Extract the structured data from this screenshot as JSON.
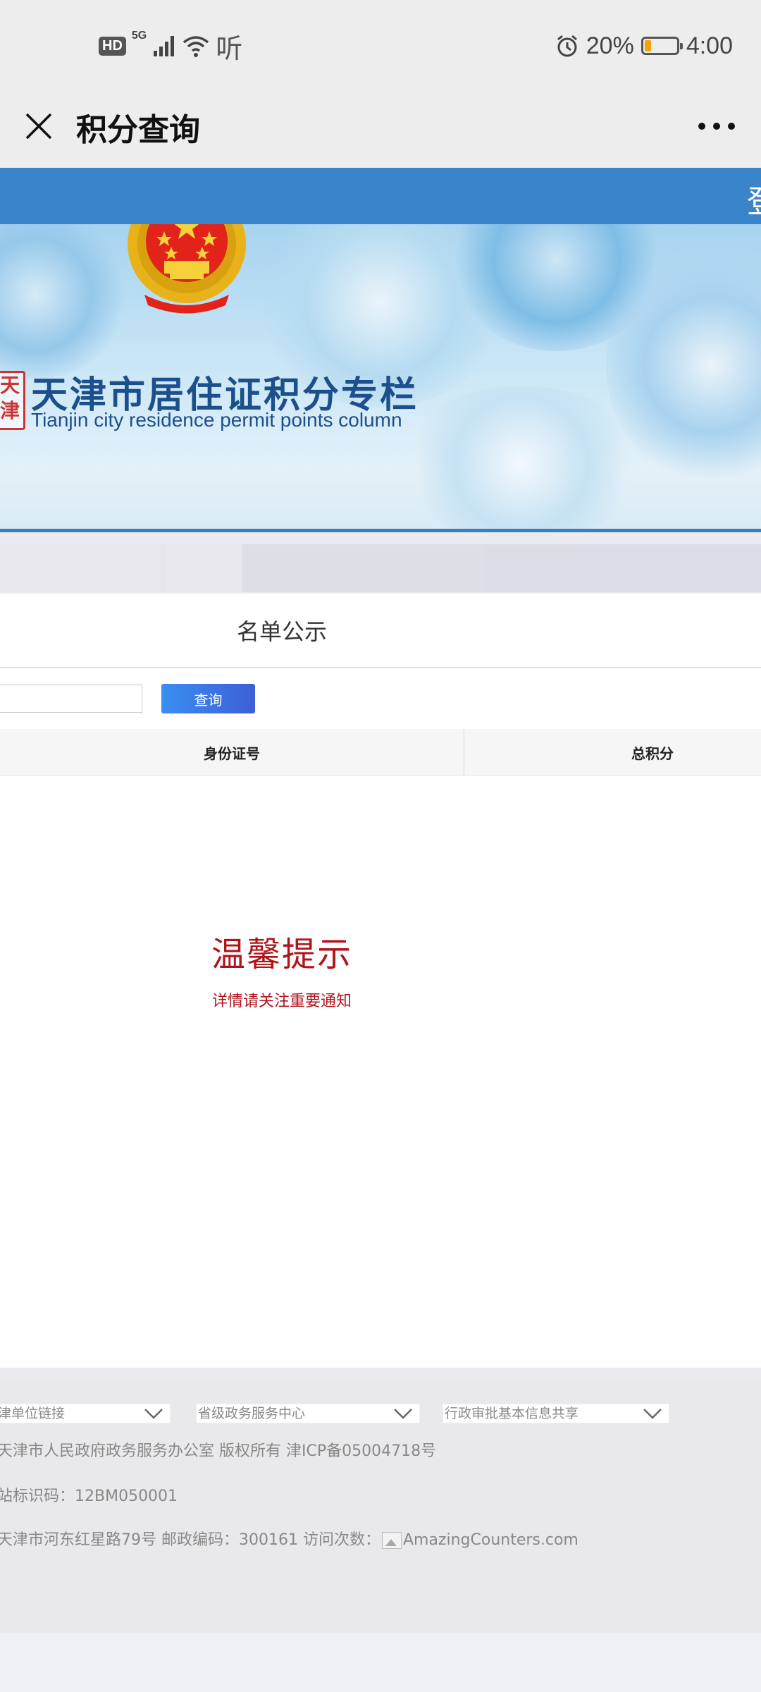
{
  "status_bar": {
    "hd": "HD",
    "network": "5G",
    "listen_icon_text": "听",
    "battery_percent": "20%",
    "battery_level": 0.2,
    "time": "4:00"
  },
  "app_header": {
    "title": "积分查询"
  },
  "blue_band": {
    "edge_text": "登"
  },
  "banner": {
    "seal_text": "天津",
    "title_cn": "天津市居住证积分专栏",
    "title_en": "Tianjin city residence permit points column"
  },
  "card": {
    "section_title": "名单公示",
    "search": {
      "value": "",
      "placeholder": ""
    },
    "query_button": "查询",
    "table": {
      "columns": [
        "身份证号",
        "总积分"
      ]
    },
    "notice": {
      "title": "温馨提示",
      "text": "详情请关注重要通知"
    }
  },
  "footer": {
    "selects": [
      "津单位链接",
      "省级政务服务中心",
      "行政审批基本信息共享"
    ],
    "lines": {
      "copyright": "天津市人民政府政务服务办公室 版权所有 津ICP备05004718号",
      "site_code": "站标识码：12BM050001",
      "address_prefix": "天津市河东红星路79号 邮政编码：300161 访问次数：",
      "counter_text": "AmazingCounters.com"
    }
  },
  "colors": {
    "brand_blue": "#3a85c9",
    "notice_red": "#b0141b",
    "button_start": "#3b8ef2",
    "button_end": "#3c5fd6",
    "battery_fill": "#f5a300"
  }
}
